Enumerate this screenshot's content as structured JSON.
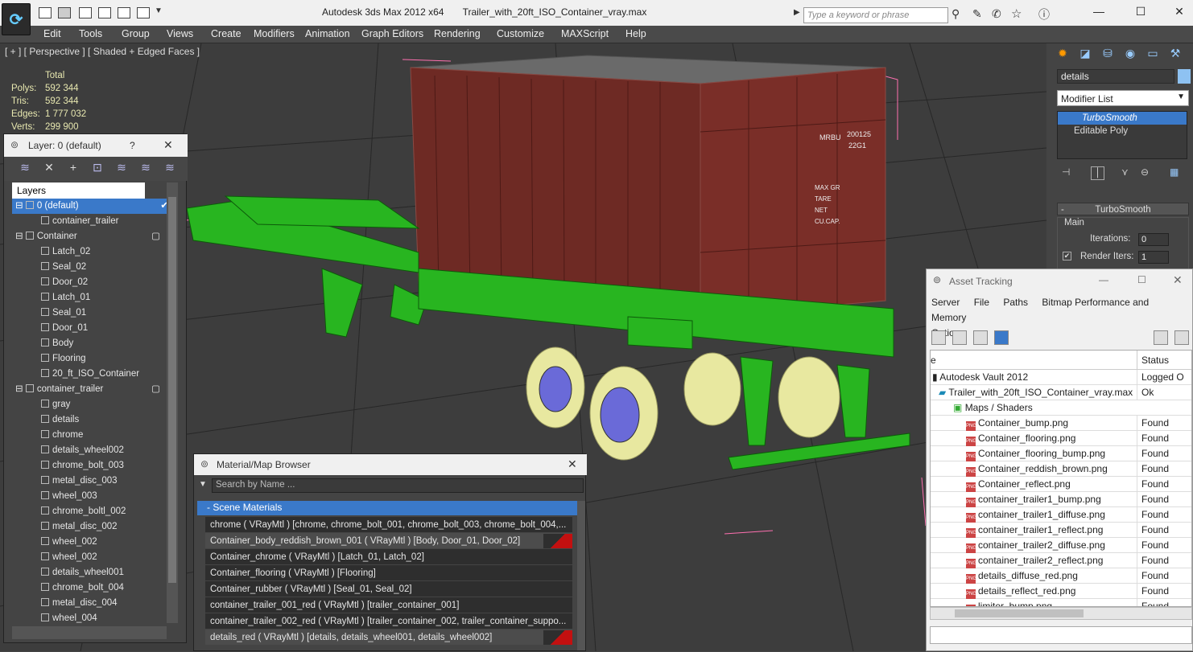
{
  "titlebar": {
    "app": "Autodesk 3ds Max  2012 x64",
    "file": "Trailer_with_20ft_ISO_Container_vray.max",
    "search_placeholder": "Type a keyword or phrase"
  },
  "menu": [
    "Edit",
    "Tools",
    "Group",
    "Views",
    "Create",
    "Modifiers",
    "Animation",
    "Graph Editors",
    "Rendering",
    "Customize",
    "MAXScript",
    "Help"
  ],
  "viewport": {
    "label": "[ + ] [ Perspective ] [ Shaded + Edged Faces ]",
    "stats_header": "Total",
    "stats": [
      {
        "k": "Polys:",
        "v": "592 344"
      },
      {
        "k": "Tris:",
        "v": "592 344"
      },
      {
        "k": "Edges:",
        "v": "1 777 032"
      },
      {
        "k": "Verts:",
        "v": "299 900"
      }
    ],
    "container_text": {
      "id1": "MRBU",
      "id2": "200125",
      "id3": "22G1",
      "weights": [
        "MAX GR",
        "TARE",
        "NET",
        "CU.CAP."
      ]
    }
  },
  "layers": {
    "title": "Layer: 0 (default)",
    "help": "?",
    "header": "Layers",
    "rows": [
      {
        "label": "0 (default)",
        "level": 0,
        "sel": true
      },
      {
        "label": "container_trailer",
        "level": 1
      },
      {
        "label": "Container",
        "level": 0
      },
      {
        "label": "Latch_02",
        "level": 1
      },
      {
        "label": "Seal_02",
        "level": 1
      },
      {
        "label": "Door_02",
        "level": 1
      },
      {
        "label": "Latch_01",
        "level": 1
      },
      {
        "label": "Seal_01",
        "level": 1
      },
      {
        "label": "Door_01",
        "level": 1
      },
      {
        "label": "Body",
        "level": 1
      },
      {
        "label": "Flooring",
        "level": 1
      },
      {
        "label": "20_ft_ISO_Container",
        "level": 1
      },
      {
        "label": "container_trailer",
        "level": 0
      },
      {
        "label": "gray",
        "level": 1
      },
      {
        "label": "details",
        "level": 1
      },
      {
        "label": "chrome",
        "level": 1
      },
      {
        "label": "details_wheel002",
        "level": 1
      },
      {
        "label": "chrome_bolt_003",
        "level": 1
      },
      {
        "label": "metal_disc_003",
        "level": 1
      },
      {
        "label": "wheel_003",
        "level": 1
      },
      {
        "label": "chrome_boltl_002",
        "level": 1
      },
      {
        "label": "metal_disc_002",
        "level": 1
      },
      {
        "label": "wheel_002",
        "level": 1
      },
      {
        "label": "wheel_002",
        "level": 1
      },
      {
        "label": "details_wheel001",
        "level": 1
      },
      {
        "label": "chrome_bolt_004",
        "level": 1
      },
      {
        "label": "metal_disc_004",
        "level": 1
      },
      {
        "label": "wheel_004",
        "level": 1
      }
    ]
  },
  "command_panel": {
    "object_name": "details",
    "modifier_list": "Modifier List",
    "stack": [
      "TurboSmooth",
      "Editable Poly"
    ],
    "rollout": "TurboSmooth",
    "group": "Main",
    "iterations_label": "Iterations:",
    "iterations": "0",
    "render_iters_label": "Render Iters:",
    "render_iters": "1"
  },
  "material_browser": {
    "title": "Material/Map Browser",
    "search_placeholder": "Search by Name ...",
    "group": "- Scene Materials",
    "rows": [
      {
        "text": "chrome  ( VRayMtl )  [chrome, chrome_bolt_001, chrome_bolt_003, chrome_bolt_004,...",
        "swatch": false
      },
      {
        "text": "Container_body_reddish_brown_001  ( VRayMtl ) [Body, Door_01, Door_02]",
        "swatch": true
      },
      {
        "text": "Container_chrome  ( VRayMtl ) [Latch_01, Latch_02]",
        "swatch": false
      },
      {
        "text": "Container_flooring  ( VRayMtl ) [Flooring]",
        "swatch": false
      },
      {
        "text": "Container_rubber  ( VRayMtl ) [Seal_01, Seal_02]",
        "swatch": false
      },
      {
        "text": "container_trailer_001_red  ( VRayMtl ) [trailer_container_001]",
        "swatch": false
      },
      {
        "text": "container_trailer_002_red  ( VRayMtl ) [trailer_container_002, trailer_container_suppo...",
        "swatch": false
      },
      {
        "text": "details_red  ( VRayMtl ) [details, details_wheel001, details_wheel002]",
        "swatch": true
      }
    ]
  },
  "asset_tracking": {
    "title": "Asset Tracking",
    "menu": [
      "Server",
      "File",
      "Paths",
      "Bitmap Performance and Memory",
      "Options"
    ],
    "col_name": "e",
    "col_status": "Status",
    "rows": [
      {
        "name": "Autodesk Vault 2012",
        "status": "Logged O",
        "indent": 0
      },
      {
        "name": "Trailer_with_20ft_ISO_Container_vray.max",
        "status": "Ok",
        "indent": 1
      },
      {
        "name": "Maps / Shaders",
        "status": "",
        "indent": 2
      },
      {
        "name": "Container_bump.png",
        "status": "Found",
        "indent": 3
      },
      {
        "name": "Container_flooring.png",
        "status": "Found",
        "indent": 3
      },
      {
        "name": "Container_flooring_bump.png",
        "status": "Found",
        "indent": 3
      },
      {
        "name": "Container_reddish_brown.png",
        "status": "Found",
        "indent": 3
      },
      {
        "name": "Container_reflect.png",
        "status": "Found",
        "indent": 3
      },
      {
        "name": "container_trailer1_bump.png",
        "status": "Found",
        "indent": 3
      },
      {
        "name": "container_trailer1_diffuse.png",
        "status": "Found",
        "indent": 3
      },
      {
        "name": "container_trailer1_reflect.png",
        "status": "Found",
        "indent": 3
      },
      {
        "name": "container_trailer2_diffuse.png",
        "status": "Found",
        "indent": 3
      },
      {
        "name": "container_trailer2_reflect.png",
        "status": "Found",
        "indent": 3
      },
      {
        "name": "details_diffuse_red.png",
        "status": "Found",
        "indent": 3
      },
      {
        "name": "details_reflect_red.png",
        "status": "Found",
        "indent": 3
      },
      {
        "name": "limiter_bump.png",
        "status": "Found",
        "indent": 3
      }
    ]
  },
  "colors": {
    "accent": "#3a79c9",
    "container": "#6e2a24",
    "trailer_wire": "#22c21a",
    "tire_wire": "#e6e6a0"
  }
}
